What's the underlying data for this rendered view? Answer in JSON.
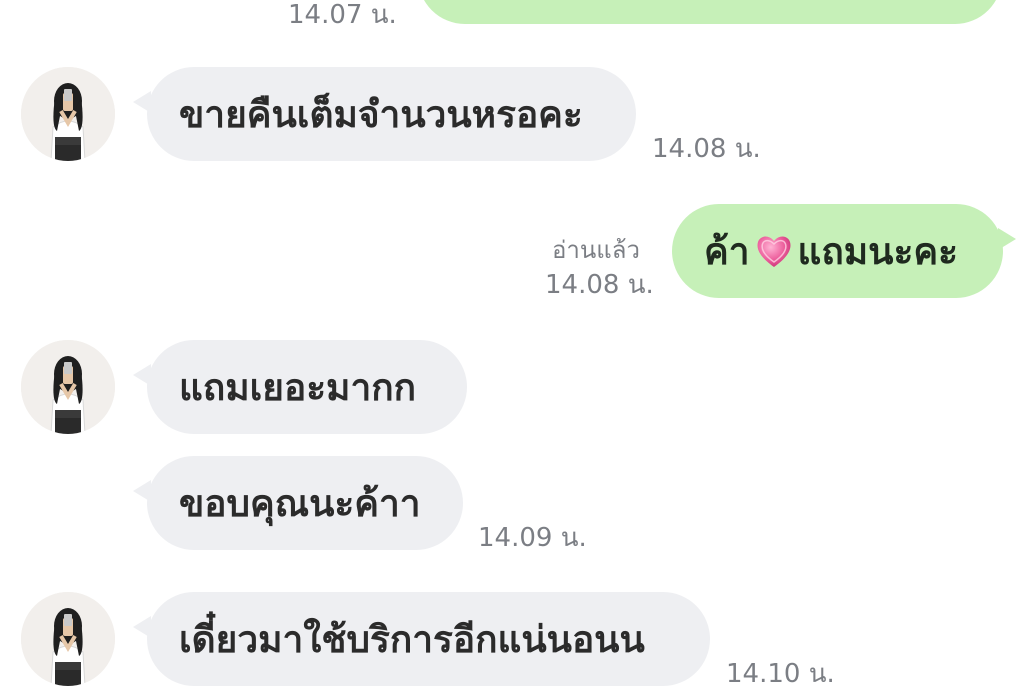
{
  "messages": [
    {
      "text": "",
      "time": "14.07 น.",
      "read": ""
    },
    {
      "text": "ขายคืนเต็มจำนวนหรอคะ",
      "time": "14.08 น.",
      "read": ""
    },
    {
      "text_before": "ค้า",
      "emoji": "heart-icon",
      "text_after": "แถมนะคะ",
      "time": "14.08 น.",
      "read": "อ่านแล้ว"
    },
    {
      "text": "แถมเยอะมากก",
      "time": "",
      "read": ""
    },
    {
      "text": "ขอบคุณนะค้าา",
      "time": "14.09 น.",
      "read": ""
    },
    {
      "text": "เดี๋ยวมาใช้บริการอีกแน่นอนน",
      "time": "14.10 น.",
      "read": ""
    }
  ],
  "colors": {
    "incoming_bubble": "#eeeff2",
    "outgoing_bubble": "#c6f0b8",
    "meta_text": "#7b7e84",
    "heart": "#e8508f"
  }
}
